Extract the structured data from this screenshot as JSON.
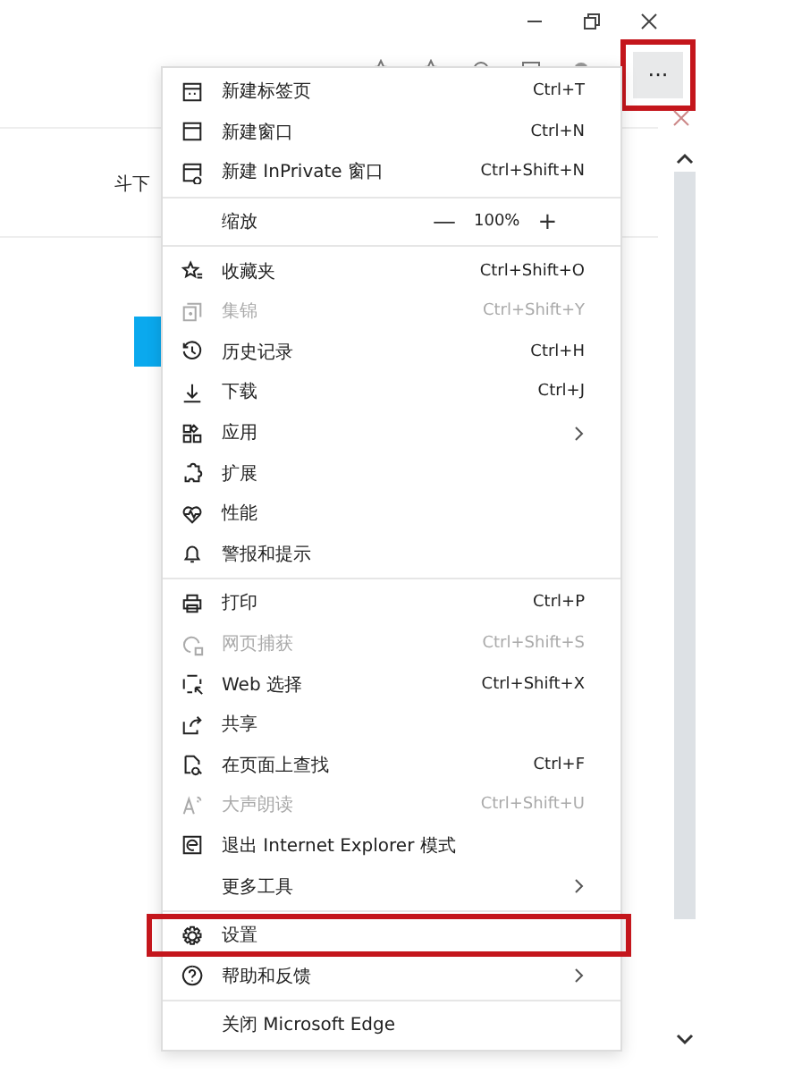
{
  "page": {
    "partial_text": "斗下"
  },
  "more_button": {
    "label": "···",
    "selected": true,
    "highlighted": true
  },
  "menu": [
    {
      "kind": "item",
      "label": "新建标签页",
      "shortcut": "Ctrl+T",
      "disabled": false,
      "submenu": false,
      "highlighted": false
    },
    {
      "kind": "item",
      "label": "新建窗口",
      "shortcut": "Ctrl+N",
      "disabled": false,
      "submenu": false,
      "highlighted": false
    },
    {
      "kind": "item",
      "label": "新建 InPrivate 窗口",
      "shortcut": "Ctrl+Shift+N",
      "disabled": false,
      "submenu": false,
      "highlighted": false
    },
    {
      "kind": "separator"
    },
    {
      "kind": "zoom",
      "label": "缩放",
      "value": "100%",
      "minus": "—",
      "plus": "+"
    },
    {
      "kind": "separator"
    },
    {
      "kind": "item",
      "label": "收藏夹",
      "shortcut": "Ctrl+Shift+O",
      "disabled": false,
      "submenu": false,
      "highlighted": false
    },
    {
      "kind": "item",
      "label": "集锦",
      "shortcut": "Ctrl+Shift+Y",
      "disabled": true,
      "submenu": false,
      "highlighted": false
    },
    {
      "kind": "item",
      "label": "历史记录",
      "shortcut": "Ctrl+H",
      "disabled": false,
      "submenu": false,
      "highlighted": false
    },
    {
      "kind": "item",
      "label": "下载",
      "shortcut": "Ctrl+J",
      "disabled": false,
      "submenu": false,
      "highlighted": false
    },
    {
      "kind": "item",
      "label": "应用",
      "disabled": false,
      "submenu": true,
      "highlighted": false
    },
    {
      "kind": "item",
      "label": "扩展",
      "disabled": false,
      "submenu": false,
      "highlighted": false
    },
    {
      "kind": "item",
      "label": "性能",
      "disabled": false,
      "submenu": false,
      "highlighted": false
    },
    {
      "kind": "item",
      "label": "警报和提示",
      "disabled": false,
      "submenu": false,
      "highlighted": false
    },
    {
      "kind": "separator"
    },
    {
      "kind": "item",
      "label": "打印",
      "shortcut": "Ctrl+P",
      "disabled": false,
      "submenu": false,
      "highlighted": false
    },
    {
      "kind": "item",
      "label": "网页捕获",
      "shortcut": "Ctrl+Shift+S",
      "disabled": true,
      "submenu": false,
      "highlighted": false
    },
    {
      "kind": "item",
      "label": "Web 选择",
      "shortcut": "Ctrl+Shift+X",
      "disabled": false,
      "submenu": false,
      "highlighted": false
    },
    {
      "kind": "item",
      "label": "共享",
      "disabled": false,
      "submenu": false,
      "highlighted": false
    },
    {
      "kind": "item",
      "label": "在页面上查找",
      "shortcut": "Ctrl+F",
      "disabled": false,
      "submenu": false,
      "highlighted": false
    },
    {
      "kind": "item",
      "label": "大声朗读",
      "shortcut": "Ctrl+Shift+U",
      "disabled": true,
      "submenu": false,
      "highlighted": false
    },
    {
      "kind": "item",
      "label": "退出 Internet Explorer 模式",
      "disabled": false,
      "submenu": false,
      "highlighted": false
    },
    {
      "kind": "item",
      "label": "更多工具",
      "disabled": false,
      "submenu": true,
      "highlighted": false
    },
    {
      "kind": "separator"
    },
    {
      "kind": "item",
      "label": "设置",
      "disabled": false,
      "submenu": false,
      "highlighted": true
    },
    {
      "kind": "item",
      "label": "帮助和反馈",
      "disabled": false,
      "submenu": true,
      "highlighted": false
    },
    {
      "kind": "separator"
    },
    {
      "kind": "item",
      "label": "关闭 Microsoft Edge",
      "disabled": false,
      "submenu": false,
      "highlighted": false
    }
  ]
}
